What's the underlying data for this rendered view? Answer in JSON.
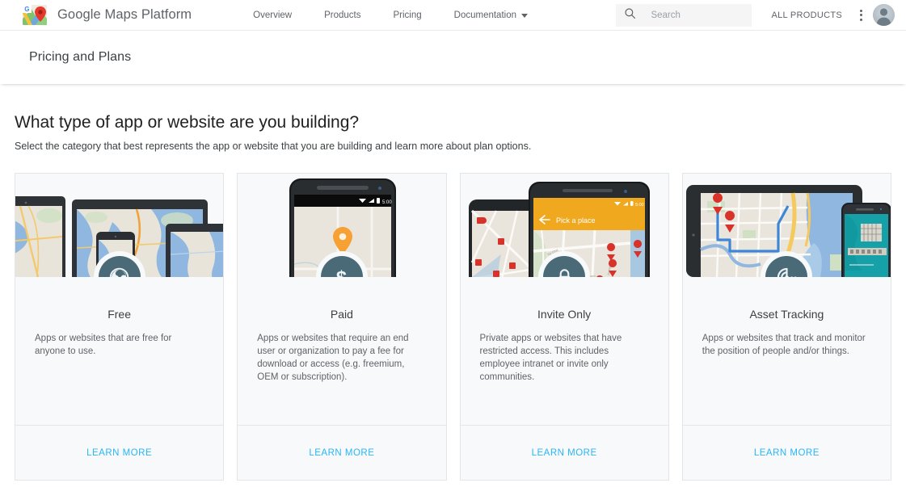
{
  "topnav": {
    "brand_title": "Google Maps Platform",
    "logo_icon": "google-maps-logo-icon",
    "links": [
      {
        "label": "Overview",
        "has_caret": false
      },
      {
        "label": "Products",
        "has_caret": false
      },
      {
        "label": "Pricing",
        "has_caret": false
      },
      {
        "label": "Documentation",
        "has_caret": true
      }
    ],
    "search": {
      "icon": "search-icon",
      "placeholder": "Search",
      "value": ""
    },
    "all_products_label": "ALL PRODUCTS",
    "kebab_icon": "more-vert-icon",
    "avatar_icon": "user-avatar-icon"
  },
  "titlebar": {
    "title": "Pricing and Plans"
  },
  "main": {
    "headline": "What type of app or website are you building?",
    "subhead": "Select the category that best represents the app or website that you are building and learn more about plan options.",
    "cards": [
      {
        "title": "Free",
        "description": "Apps or websites that are free for anyone to use.",
        "icon": "globe-icon",
        "cta": "LEARN MORE",
        "art": "multi-device-map-art"
      },
      {
        "title": "Paid",
        "description": "Apps or websites that require an end user or organization to pay a fee for download or access (e.g. freemium, OEM or subscription).",
        "icon": "dollar-sign-icon",
        "cta": "LEARN MORE",
        "art": "phone-map-pin-art",
        "status_bar_time": "5:00"
      },
      {
        "title": "Invite Only",
        "description": "Private apps or websites that have restricted access. This includes employee intranet or invite only communities.",
        "icon": "lock-icon",
        "cta": "LEARN MORE",
        "art": "two-phones-places-art",
        "app_bar_label": "Pick a place",
        "status_bar_time": "5:00"
      },
      {
        "title": "Asset Tracking",
        "description": "Apps or websites that track and monitor the position of people and/or things.",
        "icon": "radar-tracking-icon",
        "cta": "LEARN MORE",
        "art": "tablet-phone-route-art"
      }
    ]
  },
  "colors": {
    "icon_circle": "#4b6a78",
    "link_blue": "#29b6f6",
    "card_bg": "#f7f9fa",
    "card_border": "#e3e6e8",
    "text_primary": "#3c4043",
    "text_secondary": "#5f6368"
  }
}
